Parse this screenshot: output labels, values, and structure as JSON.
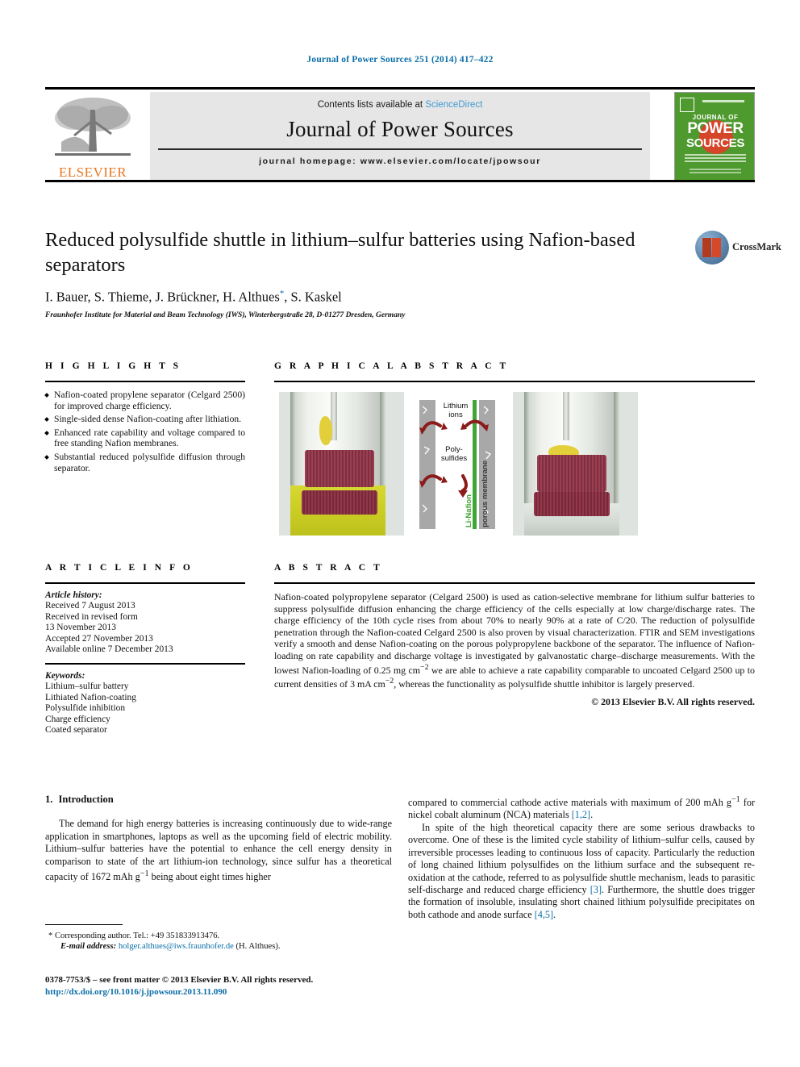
{
  "running_head": "Journal of Power Sources 251 (2014) 417–422",
  "masthead": {
    "contents_prefix": "Contents lists available at",
    "sciencedirect": "ScienceDirect",
    "journal_title": "Journal of Power Sources",
    "homepage": "journal homepage: www.elsevier.com/locate/jpowsour",
    "publisher_logo_text": "ELSEVIER",
    "cover": {
      "journal_of": "JOURNAL OF",
      "power": "POWER",
      "sources": "SOURCES"
    }
  },
  "article": {
    "title": "Reduced polysulfide shuttle in lithium–sulfur batteries using Nafion-based separators",
    "authors": "I. Bauer, S. Thieme, J. Brückner, H. Althues",
    "authors_tail": ", S. Kaskel",
    "corresponding_marker": "*",
    "affiliation": "Fraunhofer Institute for Material and Beam Technology (IWS), Winterbergstraße 28, D-01277 Dresden, Germany",
    "crossmark_label": "CrossMark"
  },
  "highlights": {
    "heading": "H I G H L I G H T S",
    "items": [
      "Nafion-coated propylene separator (Celgard 2500) for improved charge efficiency.",
      "Single-sided dense Nafion-coating after lithiation.",
      "Enhanced rate capability and voltage compared to free standing Nafion membranes.",
      "Substantial reduced polysulfide diffusion through separator."
    ]
  },
  "graphical_abstract": {
    "heading": "G R A P H I C A L   A B S T R A C T",
    "schematic": {
      "lithium_ions": "Lithium ions",
      "polysulfides": "Poly-\nsulfides",
      "li_nafion": "Li-Nafion",
      "porous_membrane": "porous membrane"
    }
  },
  "article_info": {
    "heading": "A R T I C L E   I N F O",
    "history_label": "Article history:",
    "history": [
      "Received 7 August 2013",
      "Received in revised form",
      "13 November 2013",
      "Accepted 27 November 2013",
      "Available online 7 December 2013"
    ],
    "keywords_label": "Keywords:",
    "keywords": [
      "Lithium–sulfur battery",
      "Lithiated Nafion-coating",
      "Polysulfide inhibition",
      "Charge efficiency",
      "Coated separator"
    ]
  },
  "abstract": {
    "heading": "A B S T R A C T",
    "text": "Nafion-coated polypropylene separator (Celgard 2500) is used as cation-selective membrane for lithium sulfur batteries to suppress polysulfide diffusion enhancing the charge efficiency of the cells especially at low charge/discharge rates. The charge efficiency of the 10th cycle rises from about 70% to nearly 90% at a rate of C/20. The reduction of polysulfide penetration through the Nafion-coated Celgard 2500 is also proven by visual characterization. FTIR and SEM investigations verify a smooth and dense Nafion-coating on the porous polypropylene backbone of the separator. The influence of Nafion-loading on rate capability and discharge voltage is investigated by galvanostatic charge–discharge measurements. With the lowest Nafion-loading of 0.25 mg cm",
    "text_sup1": "−2",
    "text_mid": " we are able to achieve a rate capability comparable to uncoated Celgard 2500 up to current densities of 3 mA cm",
    "text_sup2": "−2",
    "text_end": ", whereas the functionality as polysulfide shuttle inhibitor is largely preserved.",
    "copyright": "© 2013 Elsevier B.V. All rights reserved."
  },
  "introduction": {
    "number": "1.",
    "heading": "Introduction",
    "p1_a": "The demand for high energy batteries is increasing continuously due to wide-range application in smartphones, laptops as well as the upcoming field of electric mobility. Lithium–sulfur batteries have the potential to enhance the cell energy density in comparison to state of the art lithium-ion technology, since sulfur has a theoretical capacity of 1672 mAh g",
    "p1_sup": "−1",
    "p1_b": " being about eight times higher",
    "p1_cont_a": "compared to commercial cathode active materials with maximum of 200 mAh g",
    "p1_cont_sup": "−1",
    "p1_cont_b": " for nickel cobalt aluminum (NCA) materials ",
    "p1_ref": "[1,2]",
    "p1_cont_c": ".",
    "p2_a": "In spite of the high theoretical capacity there are some serious drawbacks to overcome. One of these is the limited cycle stability of lithium–sulfur cells, caused by irreversible processes leading to continuous loss of capacity. Particularly the reduction of long chained lithium polysulfides on the lithium surface and the subsequent re-oxidation at the cathode, referred to as polysulfide shuttle mechanism, leads to parasitic self-discharge and reduced charge efficiency ",
    "p2_ref1": "[3]",
    "p2_b": ". Furthermore, the shuttle does trigger the formation of insoluble, insulating short chained lithium polysulfide precipitates on both cathode and anode surface ",
    "p2_ref2": "[4,5]",
    "p2_c": "."
  },
  "footnote": {
    "star": "*",
    "corresponding": "Corresponding author. Tel.: +49 351833913476.",
    "email_label": "E-mail address:",
    "email": "holger.althues@iws.fraunhofer.de",
    "email_owner": "(H. Althues)."
  },
  "page_footer": {
    "issn_line": "0378-7753/$ – see front matter © 2013 Elsevier B.V. All rights reserved.",
    "doi": "http://dx.doi.org/10.1016/j.jpowsour.2013.11.090"
  }
}
